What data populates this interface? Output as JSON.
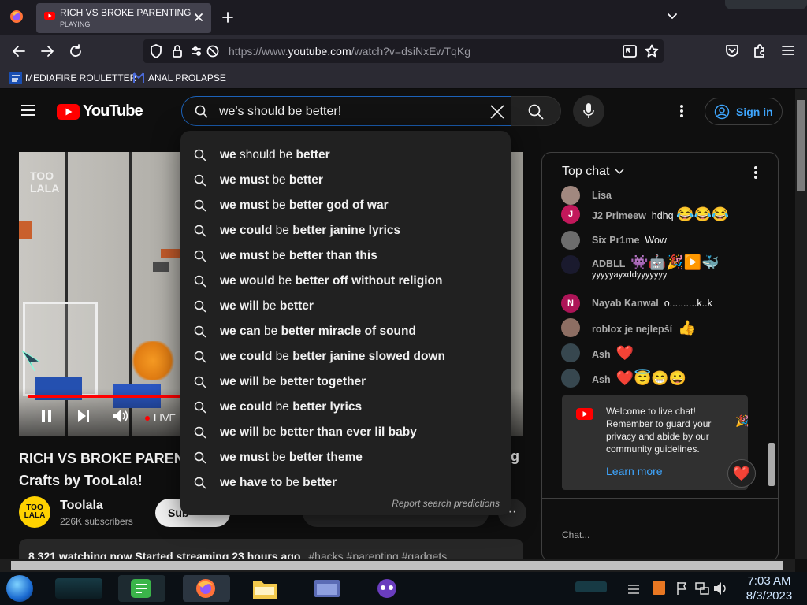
{
  "browser": {
    "tab": {
      "title": "RICH VS BROKE PARENTING HA",
      "status": "PLAYING"
    },
    "url_prefix": "https://www.",
    "url_domain": "youtube.com",
    "url_path": "/watch?v=dsiNxEwTqKg",
    "bookmarks": [
      {
        "label": "MEDIAFIRE ROULETTER",
        "icon": "mediafire-icon"
      },
      {
        "label": "ANAL PROLAPSE",
        "icon": "bookmark-icon"
      }
    ]
  },
  "youtube": {
    "logo_text": "YouTube",
    "search_value": "we's should be better!",
    "sign_in_label": "Sign in",
    "suggestions": [
      {
        "bold": "we",
        "norm": " should be ",
        "bold2": "better"
      },
      {
        "bold": "we must",
        "norm": " be ",
        "bold2": "better"
      },
      {
        "bold": "we must",
        "norm": " be ",
        "bold2": "better god of war"
      },
      {
        "bold": "we could",
        "norm": " be ",
        "bold2": "better janine lyrics"
      },
      {
        "bold": "we must",
        "norm": " be ",
        "bold2": "better than this"
      },
      {
        "bold": "we would",
        "norm": " be ",
        "bold2": "better off without religion"
      },
      {
        "bold": "we will",
        "norm": " be ",
        "bold2": "better"
      },
      {
        "bold": "we can",
        "norm": " be ",
        "bold2": "better miracle of sound"
      },
      {
        "bold": "we could",
        "norm": " be ",
        "bold2": "better janine slowed down"
      },
      {
        "bold": "we will",
        "norm": " be ",
        "bold2": "better together"
      },
      {
        "bold": "we could",
        "norm": " be ",
        "bold2": "better lyrics"
      },
      {
        "bold": "we will",
        "norm": " be ",
        "bold2": "better than ever lil baby"
      },
      {
        "bold": "we must",
        "norm": " be ",
        "bold2": "better theme"
      },
      {
        "bold": "we have to",
        "norm": " be ",
        "bold2": "better"
      }
    ],
    "report_label": "Report search predictions",
    "video": {
      "live_label": "LIVE",
      "title_line1": "RICH VS BROKE PAREN",
      "title_line2": "Crafts by TooLala!",
      "title_tail": "g",
      "channel": "Toolala",
      "subscribers": "226K subscribers",
      "subscribe_label": "Sub",
      "description_line": "8,321 watching now  Started streaming 23 hours ago",
      "hashtags": "#hacks #parenting #gadgets"
    },
    "chat": {
      "header": "Top chat",
      "partial_author": "Lisa",
      "messages": [
        {
          "author": "J2 Primeew",
          "text": "hdhq",
          "emoji": "😂😂😂",
          "avatar_letter": "J",
          "avatar_color": "#c2185b"
        },
        {
          "author": "Six Pr1me",
          "text": "Wow",
          "emoji": "",
          "avatar_letter": "",
          "avatar_color": "#6d6d6d"
        },
        {
          "author": "ADBLL",
          "text": "",
          "emoji": "👾🤖🎉▶️🐳",
          "avatar_letter": "",
          "avatar_color": "#1a1a2e"
        },
        {
          "author": "Nayab Kanwal",
          "text": "o..........k..k",
          "emoji": "",
          "avatar_letter": "N",
          "avatar_color": "#ad1457"
        },
        {
          "author": "roblox je nejlepší",
          "text": "",
          "emoji": "👍",
          "avatar_letter": "",
          "avatar_color": "#8d6e63"
        },
        {
          "author": "Ash",
          "text": "",
          "emoji": "❤️",
          "avatar_letter": "",
          "avatar_color": "#37474f"
        },
        {
          "author": "Ash",
          "text": "",
          "emoji": "❤️😇😁😀",
          "avatar_letter": "",
          "avatar_color": "#37474f"
        }
      ],
      "adbll_second_line": "yyyyyayxddyyyyyyy",
      "welcome_text": "Welcome to live chat! Remember to guard your privacy and abide by our community guidelines.",
      "learn_more": "Learn more",
      "input_placeholder": "Chat..."
    }
  },
  "taskbar": {
    "time": "7:03 AM",
    "date": "8/3/2023"
  },
  "colors": {
    "accent": "#3ea6ff",
    "youtube_red": "#ff0000",
    "search_focus": "#1c62b9"
  }
}
